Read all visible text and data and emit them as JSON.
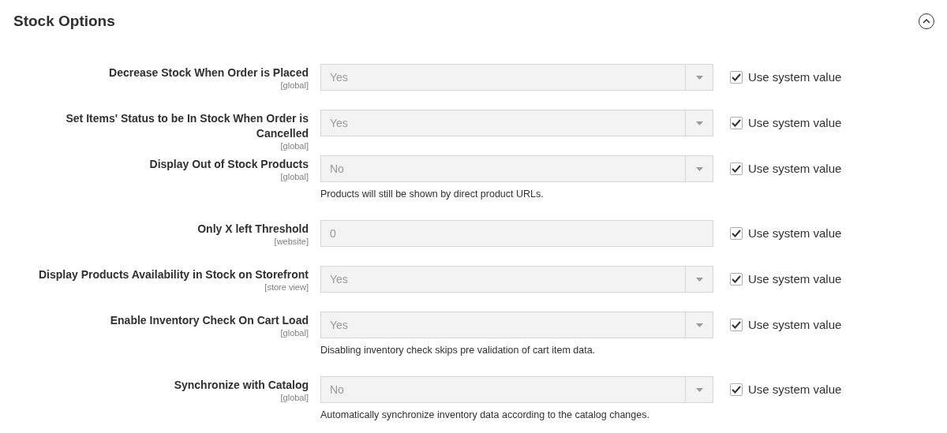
{
  "section": {
    "title": "Stock Options",
    "expanded": true
  },
  "fields": [
    {
      "label": "Decrease Stock When Order is Placed",
      "scope": "[global]",
      "kind": "select",
      "value": "Yes",
      "use_system_value": true,
      "checkbox_label": "Use system value"
    },
    {
      "label": "Set Items' Status to be In Stock When Order is Cancelled",
      "scope": "[global]",
      "kind": "select",
      "value": "Yes",
      "use_system_value": true,
      "checkbox_label": "Use system value"
    },
    {
      "label": "Display Out of Stock Products",
      "scope": "[global]",
      "kind": "select",
      "value": "No",
      "use_system_value": true,
      "checkbox_label": "Use system value",
      "note": "Products will still be shown by direct product URLs."
    },
    {
      "label": "Only X left Threshold",
      "scope": "[website]",
      "kind": "text",
      "value": "0",
      "use_system_value": true,
      "checkbox_label": "Use system value"
    },
    {
      "label": "Display Products Availability in Stock on Storefront",
      "scope": "[store view]",
      "kind": "select",
      "value": "Yes",
      "use_system_value": true,
      "checkbox_label": "Use system value"
    },
    {
      "label": "Enable Inventory Check On Cart Load",
      "scope": "[global]",
      "kind": "select",
      "value": "Yes",
      "use_system_value": true,
      "checkbox_label": "Use system value",
      "note": "Disabling inventory check skips pre validation of cart item data."
    },
    {
      "label": "Synchronize with Catalog",
      "scope": "[global]",
      "kind": "select",
      "value": "No",
      "use_system_value": true,
      "checkbox_label": "Use system value",
      "note": "Automatically synchronize inventory data according to the catalog changes."
    }
  ]
}
